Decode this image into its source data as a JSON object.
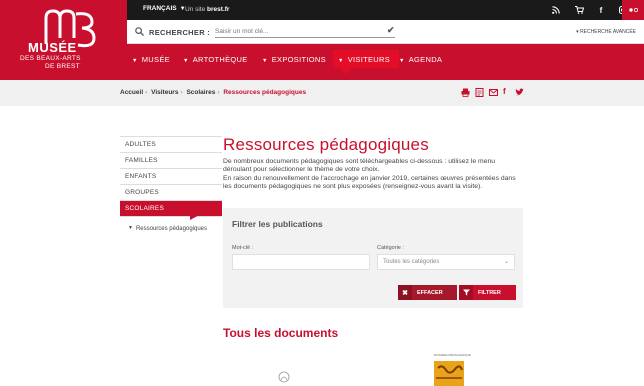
{
  "logo": {
    "line1": "MUSÉE",
    "line2": "DES BEAUX-ARTS",
    "line3": "DE BREST"
  },
  "topbar": {
    "language": "FRANÇAIS",
    "site_prefix": "Un site",
    "site_name": "brest.fr",
    "social": [
      "rss-icon",
      "cart-icon",
      "facebook-icon",
      "instagram-icon",
      "flickr-icon"
    ]
  },
  "search": {
    "label": "RECHERCHER :",
    "placeholder": "Saisir un mot clé...",
    "advanced": "RECHERCHE AVANCÉE"
  },
  "nav": {
    "items": [
      "MUSÉE",
      "ARTOTHÈQUE",
      "EXPOSITIONS",
      "VISITEURS",
      "AGENDA"
    ],
    "active": "VISITEURS"
  },
  "breadcrumb": {
    "items": [
      "Accueil",
      "Visiteurs",
      "Scolaires"
    ],
    "current": "Ressources pédagogiques"
  },
  "sidebar": {
    "items": [
      "ADULTES",
      "FAMILLES",
      "ENFANTS",
      "GROUPES",
      "SCOLAIRES"
    ],
    "active": "SCOLAIRES",
    "sub": "Ressources pédagogiques"
  },
  "main": {
    "title": "Ressources pédagogiques",
    "p1": "De nombreux documents pédagogiques sont téléchargeables ci-dessous : utilisez le menu déroulant pour sélectionner le thème de votre choix.",
    "p2": "En raison du renouvellement de l'accrochage en janvier 2019, certaines œuvres présentées dans les documents pédagogiques ne sont plus exposées (renseignez-vous avant la visite)."
  },
  "filter": {
    "title": "Filtrer les publications",
    "keyword_label": "Mot-clé :",
    "category_label": "Catégorie :",
    "category_value": "Toutes les catégories",
    "clear_label": "EFFACER",
    "filter_label": "FILTRER"
  },
  "documents": {
    "heading": "Tous les documents",
    "doc2_label": "DOSSIER PÉDAGOGIQUE"
  },
  "colors": {
    "brand": "#c8102e",
    "dark": "#1a1a1a",
    "light": "#f2f2f2"
  }
}
